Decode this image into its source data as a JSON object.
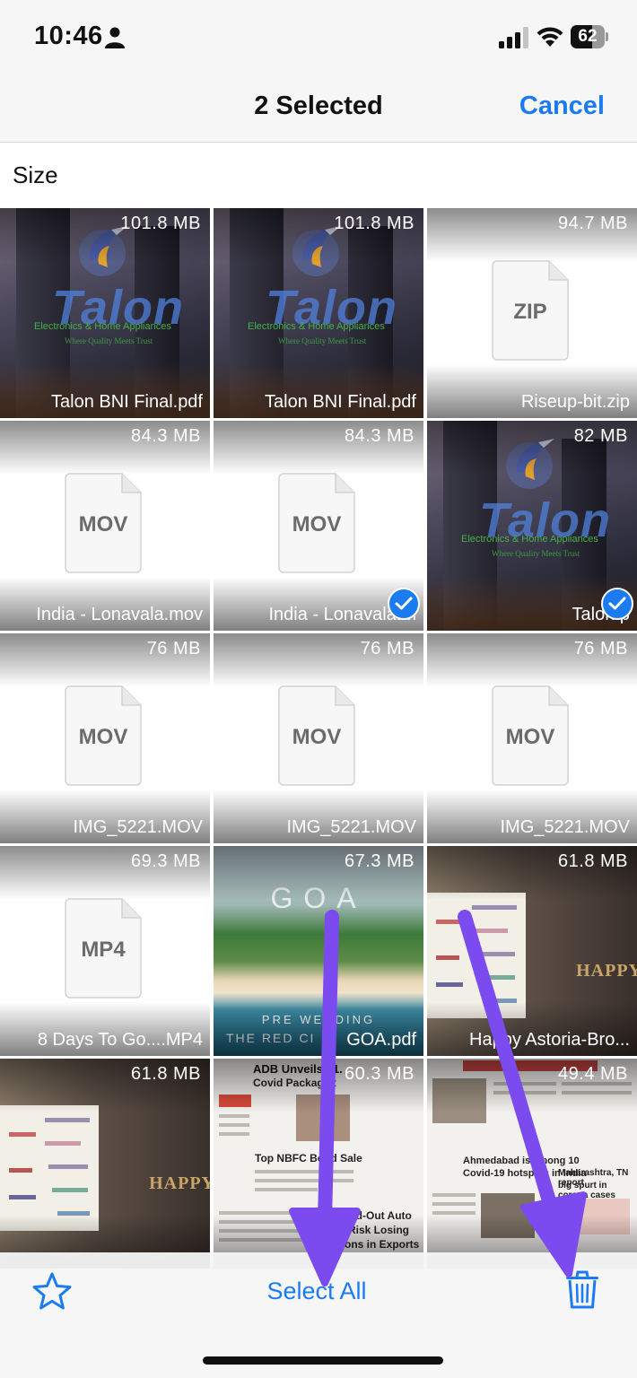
{
  "status_bar": {
    "time": "10:46",
    "battery": 62,
    "battery_label": "62"
  },
  "nav": {
    "title": "2 Selected",
    "cancel_label": "Cancel"
  },
  "sort_label": "Size",
  "files": [
    {
      "size": "101.8 MB",
      "name": "Talon BNI Final.pdf",
      "thumb": "talon",
      "selected": false
    },
    {
      "size": "101.8 MB",
      "name": "Talon BNI Final.pdf",
      "thumb": "talon",
      "selected": false
    },
    {
      "size": "94.7 MB",
      "name": "Riseup-bit.zip",
      "thumb": "doc",
      "doc_label": "ZIP",
      "selected": false
    },
    {
      "size": "84.3 MB",
      "name": "India - Lonavala.mov",
      "thumb": "doc",
      "doc_label": "MOV",
      "selected": false
    },
    {
      "size": "84.3 MB",
      "name": "India - Lonavala.m",
      "thumb": "doc",
      "doc_label": "MOV",
      "selected": true
    },
    {
      "size": "82 MB",
      "name": "Talon.p",
      "thumb": "talon",
      "selected": true
    },
    {
      "size": "76 MB",
      "name": "IMG_5221.MOV",
      "thumb": "doc",
      "doc_label": "MOV",
      "selected": false
    },
    {
      "size": "76 MB",
      "name": "IMG_5221.MOV",
      "thumb": "doc",
      "doc_label": "MOV",
      "selected": false
    },
    {
      "size": "76 MB",
      "name": "IMG_5221.MOV",
      "thumb": "doc",
      "doc_label": "MOV",
      "selected": false
    },
    {
      "size": "69.3 MB",
      "name": "8 Days To Go....MP4",
      "thumb": "doc",
      "doc_label": "MP4",
      "selected": false
    },
    {
      "size": "67.3 MB",
      "name": "GOA.pdf",
      "thumb": "goa",
      "selected": false
    },
    {
      "size": "61.8 MB",
      "name": "Happy Astoria-Bro...",
      "thumb": "happy",
      "selected": false
    },
    {
      "size": "61.8 MB",
      "name": "",
      "thumb": "happy",
      "selected": false
    },
    {
      "size": "60.3 MB",
      "name": "",
      "thumb": "news",
      "selected": false
    },
    {
      "size": "49.4 MB",
      "name": "",
      "thumb": "news2",
      "selected": false
    }
  ],
  "thumb_text": {
    "talon_logo": "Talon",
    "talon_tagline": "Electronics & Home Appliances",
    "talon_motto": "Where Quality Meets Trust",
    "goa_title": "GOA",
    "goa_sub": "PRE WEDDING",
    "goa_sub2": "THE RED CI",
    "happy_text": "HAPPY",
    "news1_head": "ADB Unveils $1.",
    "news1_hl1": "Covid Package t",
    "news1_hl2": "Top NBFC Bond Sale",
    "news1_hl3": "Locked-Out Auto",
    "news1_hl4": "Cos Risk Losing",
    "news1_hl5": "Billions in Exports",
    "news2_hl1": "Ahmedabad is among 10",
    "news2_hl2": "Covid-19 hotspots in India",
    "news2_hl3": "Maharashtra, TN report",
    "news2_hl4": "big spurt in corona cases"
  },
  "toolbar": {
    "select_all_label": "Select All"
  },
  "colors": {
    "accent": "#1b7cf2",
    "annotation_arrow": "#7b4bf0"
  },
  "icons": [
    "person-icon",
    "signal-icon",
    "wifi-icon",
    "star-icon",
    "trash-icon",
    "checkmark-icon"
  ]
}
